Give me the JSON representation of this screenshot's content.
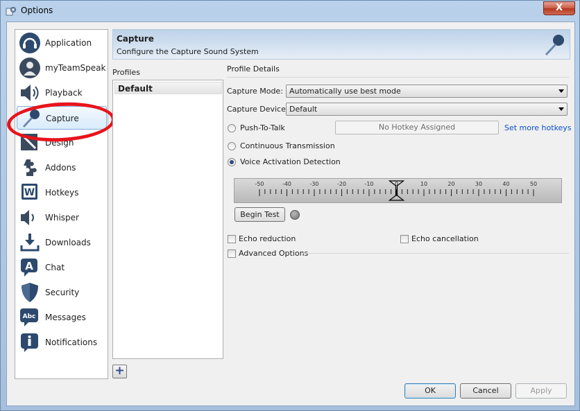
{
  "window": {
    "title": "Options",
    "close_label": "X"
  },
  "nav": {
    "items": [
      {
        "label": "Application",
        "icon": "headset-icon"
      },
      {
        "label": "myTeamSpeak",
        "icon": "user-icon"
      },
      {
        "label": "Playback",
        "icon": "speaker-icon"
      },
      {
        "label": "Capture",
        "icon": "microphone-icon",
        "selected": true
      },
      {
        "label": "Design",
        "icon": "brush-icon"
      },
      {
        "label": "Addons",
        "icon": "puzzle-icon"
      },
      {
        "label": "Hotkeys",
        "icon": "keyboard-icon"
      },
      {
        "label": "Whisper",
        "icon": "whisper-icon"
      },
      {
        "label": "Downloads",
        "icon": "download-icon"
      },
      {
        "label": "Chat",
        "icon": "chat-icon"
      },
      {
        "label": "Security",
        "icon": "shield-icon"
      },
      {
        "label": "Messages",
        "icon": "messages-icon"
      },
      {
        "label": "Notifications",
        "icon": "info-icon"
      }
    ]
  },
  "banner": {
    "title": "Capture",
    "subtitle": "Configure the Capture Sound System"
  },
  "profiles": {
    "label": "Profiles",
    "items": [
      "Default"
    ],
    "add_label": "+"
  },
  "details": {
    "label": "Profile Details",
    "capture_mode": {
      "label": "Capture Mode:",
      "value": "Automatically use best mode"
    },
    "capture_device": {
      "label": "Capture Device:",
      "value": "Default"
    },
    "push_to_talk": {
      "label": "Push-To-Talk",
      "checked": false
    },
    "hotkey_value": "No Hotkey Assigned",
    "hotkey_link": "Set more hotkeys",
    "continuous": {
      "label": "Continuous Transmission",
      "checked": false
    },
    "vad": {
      "label": "Voice Activation Detection",
      "checked": true
    },
    "slider": {
      "tick_labels": [
        "-50",
        "-40",
        "-30",
        "-20",
        "-10",
        "0",
        "10",
        "20",
        "30",
        "40",
        "50"
      ],
      "value": 0
    },
    "begin_test_label": "Begin Test",
    "echo_reduction": {
      "label": "Echo reduction",
      "checked": false
    },
    "echo_cancellation": {
      "label": "Echo cancellation",
      "checked": false
    },
    "advanced_options": {
      "label": "Advanced Options",
      "checked": false
    }
  },
  "buttons": {
    "ok": "OK",
    "cancel": "Cancel",
    "apply": "Apply"
  },
  "colors": {
    "highlight": "#e8131c",
    "link": "#0b50c7",
    "accent": "#2c4d7e"
  }
}
